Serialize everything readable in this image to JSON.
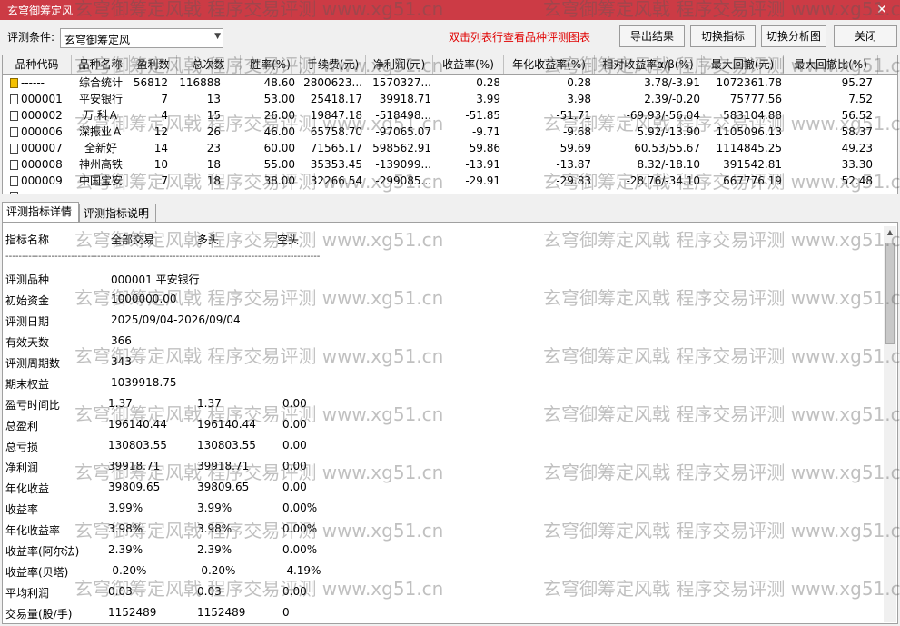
{
  "window": {
    "title": "玄穹御筹定风",
    "close": "✕"
  },
  "toolbar": {
    "label": "评测条件:",
    "combo_value": "玄穹御筹定风",
    "hint": "双击列表行查看品种评测图表",
    "buttons": [
      "导出结果",
      "切换指标",
      "切换分析图",
      "关闭"
    ]
  },
  "table": {
    "columns": [
      "品种代码",
      "品种名称",
      "盈利数",
      "总次数",
      "胜率(%)",
      "手续费(元)",
      "净利润(元)",
      "收益率(%)",
      "年化收益率(%)",
      "相对收益率α/β(%)",
      "最大回撤(元)",
      "最大回撤比(%)"
    ],
    "rows": [
      {
        "code": "------",
        "name": "综合统计",
        "win": "56812",
        "total": "116888",
        "rate": "48.60",
        "fee": "2800623...",
        "profit": "1570327...",
        "ret": "0.28",
        "annual": "0.28",
        "alpha": "3.78/-3.91",
        "dd": "1072361.78",
        "ddr": "95.27",
        "summary": true
      },
      {
        "code": "000001",
        "name": "平安银行",
        "win": "7",
        "total": "13",
        "rate": "53.00",
        "fee": "25418.17",
        "profit": "39918.71",
        "ret": "3.99",
        "annual": "3.98",
        "alpha": "2.39/-0.20",
        "dd": "75777.56",
        "ddr": "7.52"
      },
      {
        "code": "000002",
        "name": "万 科Ａ",
        "win": "4",
        "total": "15",
        "rate": "26.00",
        "fee": "19847.18",
        "profit": "-518498...",
        "ret": "-51.85",
        "annual": "-51.71",
        "alpha": "-69.93/-56.04",
        "dd": "583104.88",
        "ddr": "56.52"
      },
      {
        "code": "000006",
        "name": "深振业Ａ",
        "win": "12",
        "total": "26",
        "rate": "46.00",
        "fee": "65758.70",
        "profit": "-97065.07",
        "ret": "-9.71",
        "annual": "-9.68",
        "alpha": "5.92/-13.90",
        "dd": "1105096.13",
        "ddr": "58.37"
      },
      {
        "code": "000007",
        "name": "全新好",
        "win": "14",
        "total": "23",
        "rate": "60.00",
        "fee": "71565.17",
        "profit": "598562.91",
        "ret": "59.86",
        "annual": "59.69",
        "alpha": "60.53/55.67",
        "dd": "1114845.25",
        "ddr": "49.23"
      },
      {
        "code": "000008",
        "name": "神州高铁",
        "win": "10",
        "total": "18",
        "rate": "55.00",
        "fee": "35353.45",
        "profit": "-139099...",
        "ret": "-13.91",
        "annual": "-13.87",
        "alpha": "8.32/-18.10",
        "dd": "391542.81",
        "ddr": "33.30"
      },
      {
        "code": "000009",
        "name": "中国宝安",
        "win": "7",
        "total": "18",
        "rate": "38.00",
        "fee": "32266.54",
        "profit": "-299085...",
        "ret": "-29.91",
        "annual": "-29.83",
        "alpha": "-28.76/-34.10",
        "dd": "667776.19",
        "ddr": "52.48"
      }
    ]
  },
  "tabs": [
    "评测指标详情",
    "评测指标说明"
  ],
  "detail": {
    "header": {
      "name": "指标名称",
      "all": "全部交易",
      "long": "多头",
      "short": "空头"
    },
    "separator": "------------------------------------------------------------------------------------------------",
    "info": [
      {
        "label": "评测品种",
        "value": "000001 平安银行"
      },
      {
        "label": "初始资金",
        "value": "1000000.00"
      },
      {
        "label": "评测日期",
        "value": "2025/09/04-2026/09/04"
      },
      {
        "label": "有效天数",
        "value": "366"
      },
      {
        "label": "评测周期数",
        "value": "343"
      },
      {
        "label": "期末权益",
        "value": "1039918.75"
      }
    ],
    "metrics": [
      {
        "label": "盈亏时间比",
        "all": "1.37",
        "long": "1.37",
        "short": "0.00"
      },
      {
        "label": "总盈利",
        "all": "196140.44",
        "long": "196140.44",
        "short": "0.00"
      },
      {
        "label": "总亏损",
        "all": "130803.55",
        "long": "130803.55",
        "short": "0.00"
      },
      {
        "label": "净利润",
        "all": "39918.71",
        "long": "39918.71",
        "short": "0.00"
      },
      {
        "label": "年化收益",
        "all": "39809.65",
        "long": "39809.65",
        "short": "0.00"
      },
      {
        "label": "收益率",
        "all": "3.99%",
        "long": "3.99%",
        "short": "0.00%"
      },
      {
        "label": "年化收益率",
        "all": "3.98%",
        "long": "3.98%",
        "short": "0.00%"
      },
      {
        "label": "收益率(阿尔法)",
        "all": "2.39%",
        "long": "2.39%",
        "short": "0.00%"
      },
      {
        "label": "收益率(贝塔)",
        "all": "-0.20%",
        "long": "-0.20%",
        "short": "-4.19%"
      },
      {
        "label": "平均利润",
        "all": "0.03",
        "long": "0.03",
        "short": "0.00"
      },
      {
        "label": "交易量(股/手)",
        "all": "1152489",
        "long": "1152489",
        "short": "0"
      }
    ]
  },
  "watermark": "玄穹御筹定风戟 程序交易评测 www.xg51.cn"
}
